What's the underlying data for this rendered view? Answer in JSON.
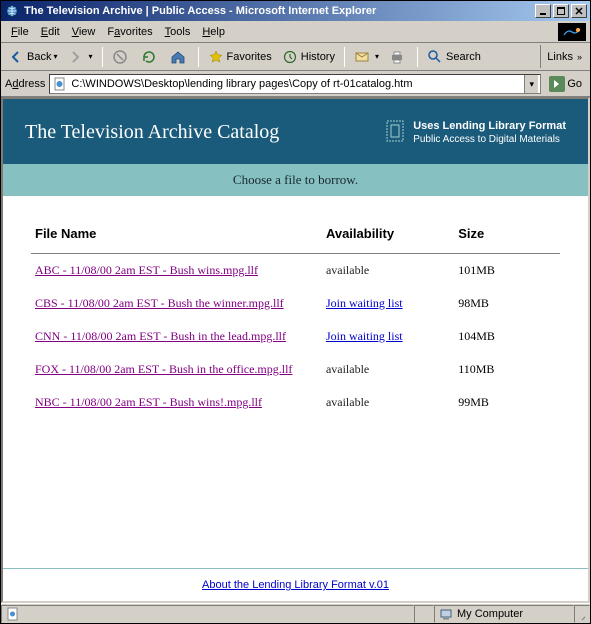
{
  "window": {
    "title": "The Television Archive | Public Access - Microsoft Internet Explorer"
  },
  "menubar": {
    "file": "File",
    "edit": "Edit",
    "view": "View",
    "favorites": "Favorites",
    "tools": "Tools",
    "help": "Help"
  },
  "toolbar": {
    "back": "Back",
    "favorites": "Favorites",
    "history": "History",
    "search": "Search",
    "links_label": "Links"
  },
  "addressbar": {
    "label": "Address",
    "url": "C:\\WINDOWS\\Desktop\\lending library pages\\Copy of rt-01catalog.htm",
    "go": "Go"
  },
  "page": {
    "banner_title": "The Television Archive Catalog",
    "banner_side_line1": "Uses Lending Library Format",
    "banner_side_line2": "Public Access to Digital Materials",
    "prompt": "Choose a file to borrow.",
    "columns": {
      "file": "File Name",
      "avail": "Availability",
      "size": "Size"
    },
    "rows": [
      {
        "file": "ABC - 11/08/00 2am EST - Bush wins.mpg.llf",
        "avail": "available",
        "avail_link": false,
        "size": "101MB"
      },
      {
        "file": "CBS - 11/08/00 2am EST - Bush the winner.mpg.llf",
        "avail": "Join waiting list",
        "avail_link": true,
        "size": "98MB"
      },
      {
        "file": "CNN - 11/08/00 2am EST - Bush in the lead.mpg.llf",
        "avail": "Join waiting list",
        "avail_link": true,
        "size": "104MB"
      },
      {
        "file": "FOX - 11/08/00 2am EST - Bush in the office.mpg.llf",
        "avail": "available",
        "avail_link": false,
        "size": "110MB"
      },
      {
        "file": "NBC - 11/08/00 2am EST - Bush wins!.mpg.llf",
        "avail": "available",
        "avail_link": false,
        "size": "99MB"
      }
    ],
    "footer_link": "About the Lending Library Format v.01"
  },
  "statusbar": {
    "done": "",
    "zone": "My Computer"
  }
}
